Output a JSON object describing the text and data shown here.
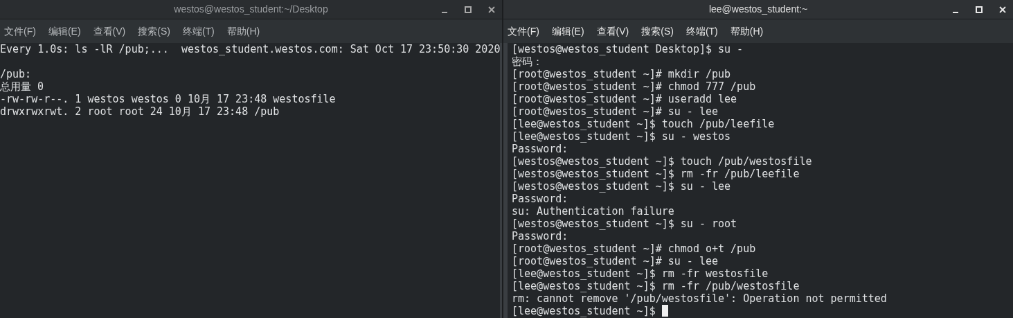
{
  "windows": [
    {
      "title": "westos@westos_student:~/Desktop",
      "active": false,
      "menu": [
        "文件(F)",
        "编辑(E)",
        "查看(V)",
        "搜索(S)",
        "终端(T)",
        "帮助(H)"
      ],
      "lines": [
        "Every 1.0s: ls -lR /pub;...  westos_student.westos.com: Sat Oct 17 23:50:30 2020",
        {
          "kind": "blank"
        },
        "/pub:",
        "总用量 0",
        "-rw-rw-r--. 1 westos westos 0 10月 17 23:48 westosfile",
        "drwxrwxrwt. 2 root root 24 10月 17 23:48 /pub"
      ]
    },
    {
      "title": "lee@westos_student:~",
      "active": true,
      "menu": [
        "文件(F)",
        "编辑(E)",
        "查看(V)",
        "搜索(S)",
        "终端(T)",
        "帮助(H)"
      ],
      "lines": [
        "[westos@westos_student Desktop]$ su -",
        "密码：",
        "[root@westos_student ~]# mkdir /pub",
        "[root@westos_student ~]# chmod 777 /pub",
        "[root@westos_student ~]# useradd lee",
        "[root@westos_student ~]# su - lee",
        "[lee@westos_student ~]$ touch /pub/leefile",
        "[lee@westos_student ~]$ su - westos",
        "Password:",
        "[westos@westos_student ~]$ touch /pub/westosfile",
        "[westos@westos_student ~]$ rm -fr /pub/leefile",
        "[westos@westos_student ~]$ su - lee",
        "Password:",
        "su: Authentication failure",
        "[westos@westos_student ~]$ su - root",
        "Password:",
        "[root@westos_student ~]# chmod o+t /pub",
        "[root@westos_student ~]# su - lee",
        "[lee@westos_student ~]$ rm -fr westosfile",
        "[lee@westos_student ~]$ rm -fr /pub/westosfile",
        "rm: cannot remove '/pub/westosfile': Operation not permitted",
        "[lee@westos_student ~]$ "
      ],
      "cursor": true
    }
  ]
}
